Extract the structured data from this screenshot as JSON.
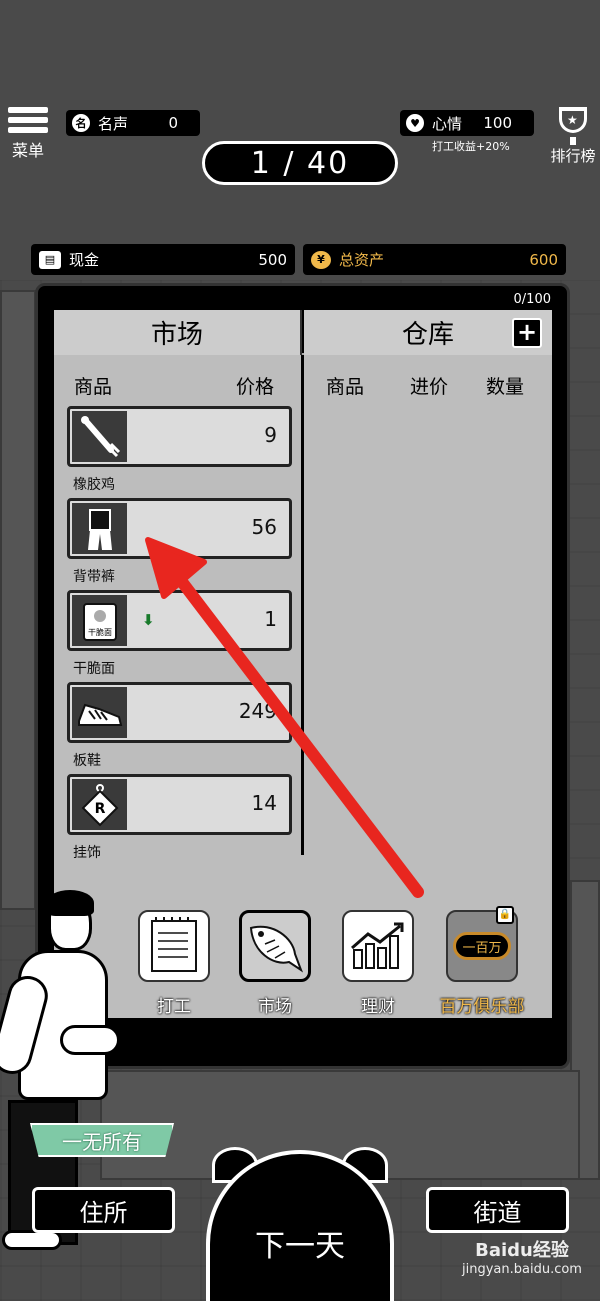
{
  "topbar": {
    "menu_label": "菜单",
    "fame_label": "名声",
    "fame_value": "0",
    "fame_icon": "名",
    "mood_label": "心情",
    "mood_value": "100",
    "mood_note": "打工收益+20%",
    "rank_label": "排行榜",
    "day": "1 / 40"
  },
  "money": {
    "cash_label": "现金",
    "cash_value": "500",
    "assets_label": "总资产",
    "assets_value": "600",
    "assets_icon": "¥",
    "assets_color": "#f0b84a"
  },
  "panel": {
    "capacity": "0/100",
    "tab_market": "市场",
    "tab_storage": "仓库",
    "plus_label": "+",
    "market_headers": [
      "商品",
      "价格"
    ],
    "storage_headers": [
      "商品",
      "进价",
      "数量"
    ],
    "items": [
      {
        "name": "橡胶鸡",
        "price": "9",
        "icon": "rubber-chicken-icon"
      },
      {
        "name": "背带裤",
        "price": "56",
        "icon": "overalls-icon"
      },
      {
        "name": "干脆面",
        "price": "1",
        "icon": "noodles-icon",
        "trend": "down",
        "package_text": "干脆面"
      },
      {
        "name": "板鞋",
        "price": "249",
        "icon": "sneakers-icon"
      },
      {
        "name": "挂饰",
        "price": "14",
        "icon": "pendant-icon"
      }
    ]
  },
  "nav": {
    "work": "打工",
    "market": "市场",
    "finance": "理财",
    "club": "百万俱乐部",
    "club_badge": "一百万"
  },
  "footer": {
    "status": "一无所有",
    "home": "住所",
    "next_day": "下一天",
    "street": "街道",
    "watermark_top": "Baidu经验",
    "watermark_bottom": "jingyan.baidu.com"
  }
}
